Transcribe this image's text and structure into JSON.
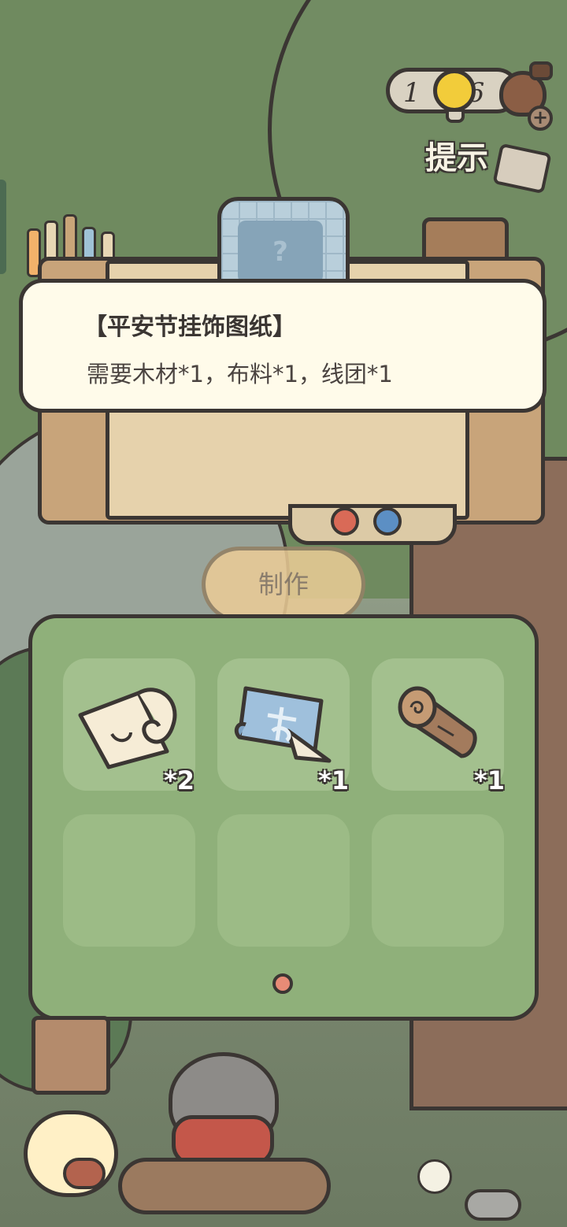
{
  "hud": {
    "hint_count": "16",
    "hint_count_tail": "1",
    "hint_label": "提示"
  },
  "blueprint": {
    "placeholder_glyph": "?"
  },
  "dialog": {
    "title": "【平安节挂饰图纸】",
    "description": "需要木材*1，布料*1，线团*1"
  },
  "actions": {
    "make_label": "制作"
  },
  "inventory": {
    "slots": [
      {
        "icon": "paper-scroll-icon",
        "quantity": "*2"
      },
      {
        "icon": "blueprint-icon",
        "quantity": "*1"
      },
      {
        "icon": "wood-log-icon",
        "quantity": "*1"
      },
      {
        "icon": null,
        "quantity": null
      },
      {
        "icon": null,
        "quantity": null
      },
      {
        "icon": null,
        "quantity": null
      }
    ],
    "page_index": 1,
    "page_count": 1
  },
  "colors": {
    "outline": "#3b3633",
    "panel_green": "#8fb07a",
    "slot_green": "#a3c08e",
    "dialog_bg": "#fffbea",
    "page_dot": "#e88b76",
    "make_button": "#eccc96"
  }
}
